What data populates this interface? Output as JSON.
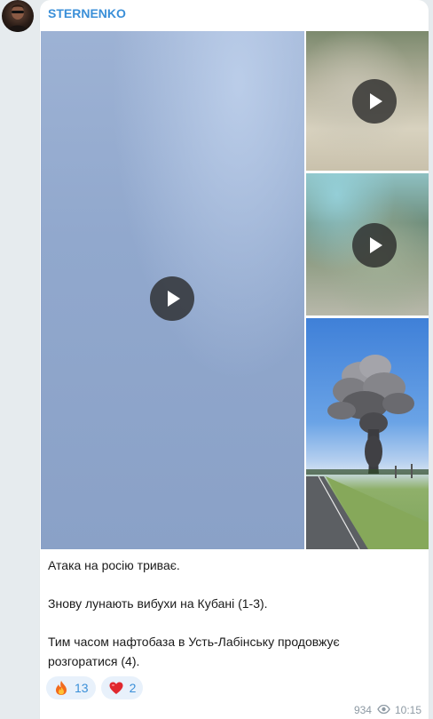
{
  "channel": {
    "name": "STERNENKO"
  },
  "media": {
    "tiles": [
      {
        "kind": "video",
        "play_icon": "play-icon"
      },
      {
        "kind": "video",
        "play_icon": "play-icon"
      },
      {
        "kind": "video",
        "play_icon": "play-icon"
      },
      {
        "kind": "photo"
      }
    ]
  },
  "caption": {
    "line1": "Атака на росію триває.",
    "line2": "Знову лунають вибухи на Кубані (1-3).",
    "line3a": "Тим часом нафтобаза в Усть-Лабінську продовжує",
    "line3b": "розгоратися (4)."
  },
  "reactions": [
    {
      "emoji": "fire-icon",
      "count": "13"
    },
    {
      "emoji": "red-heart-icon",
      "count": "2"
    }
  ],
  "meta": {
    "views": "934",
    "time": "10:15"
  },
  "colors": {
    "accent": "#3a8fd8",
    "reaction_bg": "#e8f1fb",
    "background": "#e6ebee"
  }
}
